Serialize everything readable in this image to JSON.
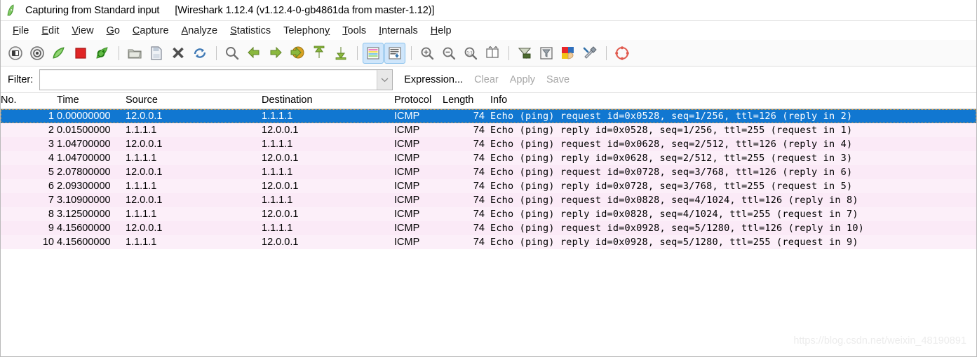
{
  "window": {
    "icon": "wireshark-shark-fin-icon",
    "title": "Capturing from Standard input",
    "subtitle": "[Wireshark 1.12.4  (v1.12.4-0-gb4861da from master-1.12)]"
  },
  "menubar": {
    "items": [
      {
        "label": "File",
        "mnemonic": "F",
        "name": "menu-file"
      },
      {
        "label": "Edit",
        "mnemonic": "E",
        "name": "menu-edit"
      },
      {
        "label": "View",
        "mnemonic": "V",
        "name": "menu-view"
      },
      {
        "label": "Go",
        "mnemonic": "G",
        "name": "menu-go"
      },
      {
        "label": "Capture",
        "mnemonic": "C",
        "name": "menu-capture"
      },
      {
        "label": "Analyze",
        "mnemonic": "A",
        "name": "menu-analyze"
      },
      {
        "label": "Statistics",
        "mnemonic": "S",
        "name": "menu-statistics"
      },
      {
        "label": "Telephony",
        "mnemonic": "y",
        "name": "menu-telephony"
      },
      {
        "label": "Tools",
        "mnemonic": "T",
        "name": "menu-tools"
      },
      {
        "label": "Internals",
        "mnemonic": "I",
        "name": "menu-internals"
      },
      {
        "label": "Help",
        "mnemonic": "H",
        "name": "menu-help"
      }
    ]
  },
  "toolbar": {
    "buttons": [
      {
        "name": "interfaces-icon",
        "pressed": false
      },
      {
        "name": "capture-options-icon",
        "pressed": false
      },
      {
        "name": "start-capture-icon",
        "pressed": false
      },
      {
        "name": "stop-capture-icon",
        "pressed": false
      },
      {
        "name": "restart-capture-icon",
        "pressed": false
      },
      {
        "name": "separator"
      },
      {
        "name": "open-file-icon",
        "pressed": false
      },
      {
        "name": "save-file-icon",
        "pressed": false
      },
      {
        "name": "close-file-icon",
        "pressed": false
      },
      {
        "name": "reload-file-icon",
        "pressed": false
      },
      {
        "name": "separator"
      },
      {
        "name": "find-packet-icon",
        "pressed": false
      },
      {
        "name": "go-back-icon",
        "pressed": false
      },
      {
        "name": "go-forward-icon",
        "pressed": false
      },
      {
        "name": "go-to-packet-icon",
        "pressed": false
      },
      {
        "name": "go-to-first-icon",
        "pressed": false
      },
      {
        "name": "go-to-last-icon",
        "pressed": false
      },
      {
        "name": "separator"
      },
      {
        "name": "colorize-packets-icon",
        "pressed": true
      },
      {
        "name": "auto-scroll-icon",
        "pressed": true
      },
      {
        "name": "separator"
      },
      {
        "name": "zoom-in-icon",
        "pressed": false
      },
      {
        "name": "zoom-out-icon",
        "pressed": false
      },
      {
        "name": "zoom-reset-icon",
        "pressed": false
      },
      {
        "name": "resize-columns-icon",
        "pressed": false
      },
      {
        "name": "separator"
      },
      {
        "name": "capture-filters-icon",
        "pressed": false
      },
      {
        "name": "display-filters-icon",
        "pressed": false
      },
      {
        "name": "coloring-rules-icon",
        "pressed": false
      },
      {
        "name": "preferences-icon",
        "pressed": false
      },
      {
        "name": "separator"
      },
      {
        "name": "help-contents-icon",
        "pressed": false
      }
    ]
  },
  "filterbar": {
    "label": "Filter:",
    "value": "",
    "placeholder": "",
    "expression_label": "Expression...",
    "clear_label": "Clear",
    "apply_label": "Apply",
    "save_label": "Save"
  },
  "packet_list": {
    "columns": [
      "No.",
      "Time",
      "Source",
      "Destination",
      "Protocol",
      "Length",
      "Info"
    ],
    "rows": [
      {
        "no": "1",
        "time": "0.00000000",
        "source": "12.0.0.1",
        "destination": "1.1.1.1",
        "protocol": "ICMP",
        "length": "74",
        "info": "Echo (ping) request  id=0x0528, seq=1/256, ttl=126 (reply in 2)",
        "selected": true
      },
      {
        "no": "2",
        "time": "0.01500000",
        "source": "1.1.1.1",
        "destination": "12.0.0.1",
        "protocol": "ICMP",
        "length": "74",
        "info": "Echo (ping) reply    id=0x0528, seq=1/256, ttl=255 (request in 1)",
        "selected": false
      },
      {
        "no": "3",
        "time": "1.04700000",
        "source": "12.0.0.1",
        "destination": "1.1.1.1",
        "protocol": "ICMP",
        "length": "74",
        "info": "Echo (ping) request  id=0x0628, seq=2/512, ttl=126 (reply in 4)",
        "selected": false
      },
      {
        "no": "4",
        "time": "1.04700000",
        "source": "1.1.1.1",
        "destination": "12.0.0.1",
        "protocol": "ICMP",
        "length": "74",
        "info": "Echo (ping) reply    id=0x0628, seq=2/512, ttl=255 (request in 3)",
        "selected": false
      },
      {
        "no": "5",
        "time": "2.07800000",
        "source": "12.0.0.1",
        "destination": "1.1.1.1",
        "protocol": "ICMP",
        "length": "74",
        "info": "Echo (ping) request  id=0x0728, seq=3/768, ttl=126 (reply in 6)",
        "selected": false
      },
      {
        "no": "6",
        "time": "2.09300000",
        "source": "1.1.1.1",
        "destination": "12.0.0.1",
        "protocol": "ICMP",
        "length": "74",
        "info": "Echo (ping) reply    id=0x0728, seq=3/768, ttl=255 (request in 5)",
        "selected": false
      },
      {
        "no": "7",
        "time": "3.10900000",
        "source": "12.0.0.1",
        "destination": "1.1.1.1",
        "protocol": "ICMP",
        "length": "74",
        "info": "Echo (ping) request  id=0x0828, seq=4/1024, ttl=126 (reply in 8)",
        "selected": false
      },
      {
        "no": "8",
        "time": "3.12500000",
        "source": "1.1.1.1",
        "destination": "12.0.0.1",
        "protocol": "ICMP",
        "length": "74",
        "info": "Echo (ping) reply    id=0x0828, seq=4/1024, ttl=255 (request in 7)",
        "selected": false
      },
      {
        "no": "9",
        "time": "4.15600000",
        "source": "12.0.0.1",
        "destination": "1.1.1.1",
        "protocol": "ICMP",
        "length": "74",
        "info": "Echo (ping) request  id=0x0928, seq=5/1280, ttl=126 (reply in 10)",
        "selected": false
      },
      {
        "no": "10",
        "time": "4.15600000",
        "source": "1.1.1.1",
        "destination": "12.0.0.1",
        "protocol": "ICMP",
        "length": "74",
        "info": "Echo (ping) reply    id=0x0928, seq=5/1280, ttl=255 (request in 9)",
        "selected": false
      }
    ]
  },
  "watermark": {
    "text": "https://blog.csdn.net/weixin_48190891"
  },
  "colors": {
    "selected_row": "#1177d1",
    "icmp_row": "#fceff9",
    "toolbar_pressed": "#cfe6fb"
  }
}
